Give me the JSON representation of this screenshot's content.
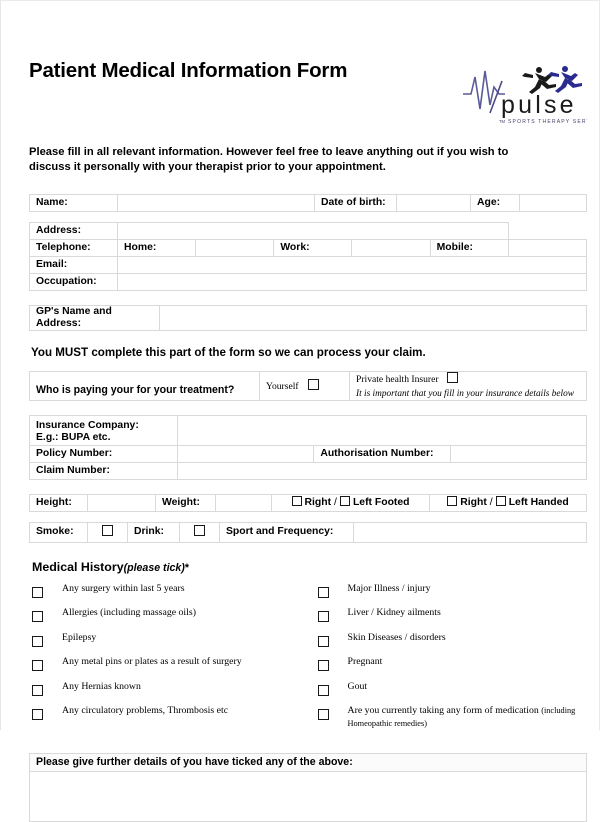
{
  "document": {
    "title": "Patient Medical Information Form",
    "intro": "Please fill in all relevant information. However feel free to leave anything out if you wish to discuss it personally with your therapist prior to your appointment.",
    "must_complete": "You MUST complete this part of the form so we can process your claim."
  },
  "logo": {
    "wordmark": "pulse",
    "tagline": "SPORTS THERAPY SERVICES",
    "trademark": "TM",
    "icon": "ecg-pulse-runners-logo",
    "colors": {
      "wordmark": "#1a1a1a",
      "tagline": "#3b3b6e",
      "runner_front": "#2b2b8f",
      "runner_back": "#1a1a1a",
      "waveform": "#4a4a8c"
    }
  },
  "identity": {
    "name_label": "Name:",
    "name_value": "",
    "dob_label": "Date of birth:",
    "dob_value": "",
    "age_label": "Age:",
    "age_value": ""
  },
  "contact": {
    "address_label": "Address:",
    "address_value": "",
    "telephone_label": "Telephone:",
    "home_label": "Home:",
    "home_value": "",
    "work_label": "Work:",
    "work_value": "",
    "mobile_label": "Mobile:",
    "mobile_value": "",
    "email_label": "Email:",
    "email_value": "",
    "occupation_label": "Occupation:",
    "occupation_value": ""
  },
  "gp": {
    "label": "GP's Name and Address:",
    "value": ""
  },
  "payment": {
    "question": "Who is paying your for your treatment?",
    "option_self": "Yourself",
    "option_insurer": "Private health Insurer",
    "insurer_note": "It is important that you fill in your  insurance details below"
  },
  "insurance": {
    "company_label_line1": "Insurance Company:",
    "company_label_line2": "E.g.: BUPA etc.",
    "company_value": "",
    "policy_label": "Policy Number:",
    "policy_value": "",
    "authorisation_label": "Authorisation Number:",
    "authorisation_value": "",
    "claim_label": "Claim Number:",
    "claim_value": ""
  },
  "physical": {
    "height_label": "Height:",
    "height_value": "",
    "weight_label": "Weight:",
    "weight_value": "",
    "foot_right": "Right",
    "foot_separator": "/",
    "foot_left": "Left Footed",
    "hand_right": "Right",
    "hand_separator": "/",
    "hand_left": "Left Handed"
  },
  "lifestyle": {
    "smoke_label": "Smoke:",
    "drink_label": "Drink:",
    "sport_label": "Sport and Frequency:",
    "sport_value": ""
  },
  "medical_history": {
    "heading": "Medical History",
    "heading_note": "(please tick)",
    "heading_asterisk": "*",
    "left_items": [
      {
        "text": "Any surgery within last 5 years"
      },
      {
        "text": "Allergies (including massage oils)"
      },
      {
        "text": "Epilepsy"
      },
      {
        "text": "Any metal pins or plates as a result of surgery"
      },
      {
        "text": "Any Hernias known"
      },
      {
        "text": "Any circulatory problems, Thrombosis etc"
      }
    ],
    "right_items": [
      {
        "text": "Major Illness / injury",
        "small": ""
      },
      {
        "text": "Liver / Kidney ailments",
        "small": ""
      },
      {
        "text": "Skin Diseases / disorders",
        "small": ""
      },
      {
        "text": "Pregnant",
        "small": ""
      },
      {
        "text": "Gout",
        "small": ""
      },
      {
        "text": "Are you currently taking any form of medication ",
        "small": "(including Homeopathic remedies)"
      }
    ]
  },
  "further_details": {
    "label": "Please give further details of you have ticked any of the above:",
    "value": ""
  }
}
